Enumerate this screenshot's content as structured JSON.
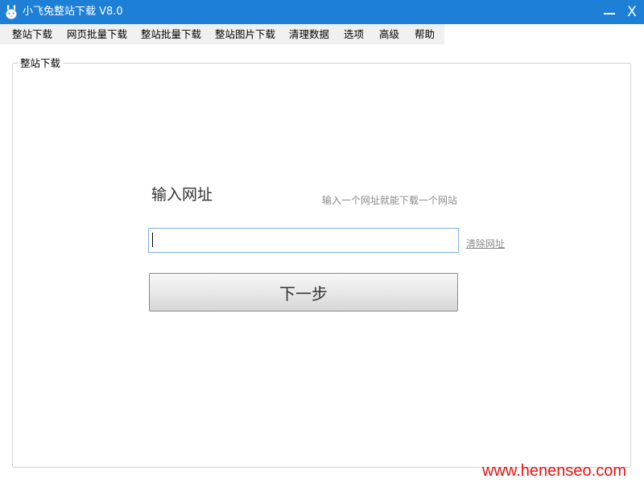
{
  "window": {
    "title": "小飞兔整站下载 V8.0",
    "icon": "rabbit-logo",
    "minimize_icon": "minimize-icon",
    "close_label": "X",
    "titlebar_color": "#1e7fd6"
  },
  "menu": {
    "items": [
      {
        "label": "整站下载"
      },
      {
        "label": "网页批量下载"
      },
      {
        "label": "整站批量下载"
      },
      {
        "label": "整站图片下载"
      },
      {
        "label": "清理数据"
      },
      {
        "label": "选项"
      },
      {
        "label": "高级"
      },
      {
        "label": "帮助"
      }
    ]
  },
  "main": {
    "group_title": "整站下载",
    "input_heading": "输入网址",
    "input_hint": "输入一个网址就能下载一个网站",
    "url_value": "",
    "clear_link": "清除网址",
    "next_button": "下一步"
  },
  "watermark": {
    "text": "www.henenseo.com",
    "color": "#ee1111"
  }
}
